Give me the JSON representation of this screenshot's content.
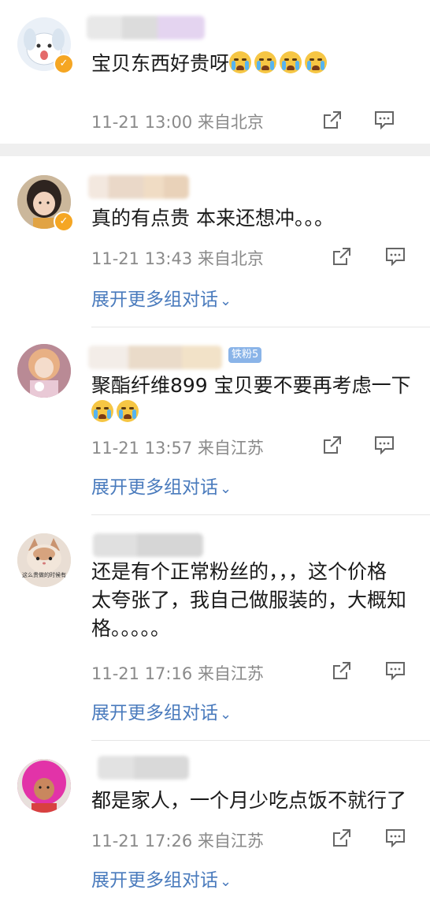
{
  "comments": [
    {
      "text": "宝贝东西好贵呀",
      "emoji_count": 4,
      "time": "11-21 13:00",
      "location": "来自北京",
      "verified": true,
      "has_expand": false
    },
    {
      "text": "真的有点贵 本来还想冲。。。",
      "time": "11-21 13:43",
      "location": "来自北京",
      "verified": true,
      "has_expand": true
    },
    {
      "text_line1": "聚酯纤维899 宝贝要不要再考虑一下",
      "emoji_count": 2,
      "badge": "铁粉5",
      "time": "11-21 13:57",
      "location": "来自江苏",
      "verified": false,
      "has_expand": true
    },
    {
      "text_line1": "还是有个正常粉丝的，，，这个价格",
      "text_line2": "太夸张了，我自己做服装的，大概知",
      "text_line3": "格。。。。。",
      "avatar_caption": "这么贵做的时候有",
      "time": "11-21 17:16",
      "location": "来自江苏",
      "verified": false,
      "has_expand": true
    },
    {
      "text": "都是家人，一个月少吃点饭不就行了",
      "time": "11-21 17:26",
      "location": "来自江苏",
      "verified": false,
      "has_expand": true
    }
  ],
  "expand_label": "展开更多组对话",
  "icons": {
    "share": "share-icon",
    "comment": "comment-icon",
    "chevron": "chevron-down-icon"
  },
  "colors": {
    "link": "#4a7bbd",
    "meta": "#8a8a8a",
    "verified": "#f5a623",
    "separator": "#efefef"
  }
}
